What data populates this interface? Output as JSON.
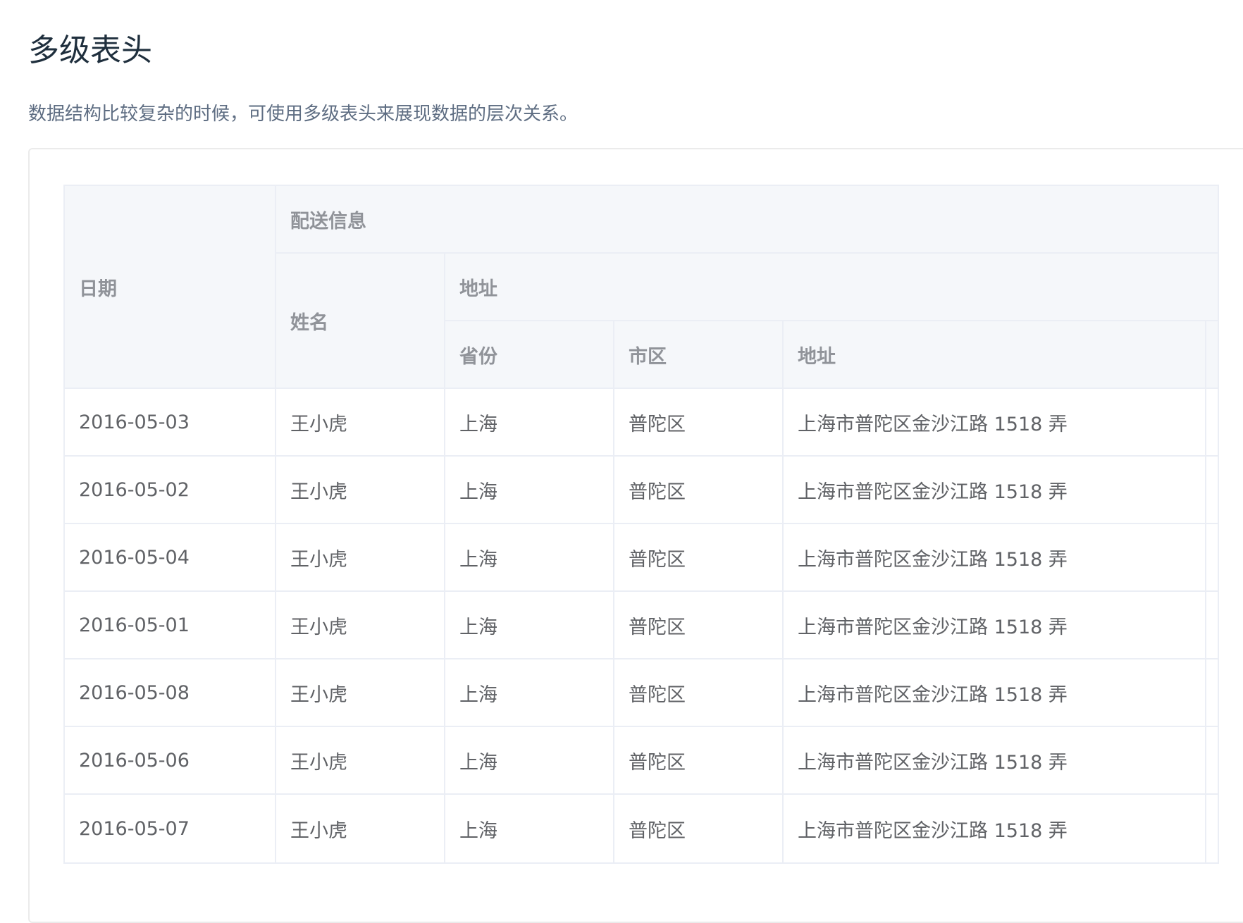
{
  "page": {
    "title": "多级表头",
    "description": "数据结构比较复杂的时候，可使用多级表头来展现数据的层次关系。"
  },
  "table": {
    "header": {
      "date": "日期",
      "delivery": "配送信息",
      "name": "姓名",
      "address_group": "地址",
      "province": "省份",
      "city": "市区",
      "address": "地址"
    },
    "rows": [
      {
        "date": "2016-05-03",
        "name": "王小虎",
        "province": "上海",
        "city": "普陀区",
        "address": "上海市普陀区金沙江路 1518 弄"
      },
      {
        "date": "2016-05-02",
        "name": "王小虎",
        "province": "上海",
        "city": "普陀区",
        "address": "上海市普陀区金沙江路 1518 弄"
      },
      {
        "date": "2016-05-04",
        "name": "王小虎",
        "province": "上海",
        "city": "普陀区",
        "address": "上海市普陀区金沙江路 1518 弄"
      },
      {
        "date": "2016-05-01",
        "name": "王小虎",
        "province": "上海",
        "city": "普陀区",
        "address": "上海市普陀区金沙江路 1518 弄"
      },
      {
        "date": "2016-05-08",
        "name": "王小虎",
        "province": "上海",
        "city": "普陀区",
        "address": "上海市普陀区金沙江路 1518 弄"
      },
      {
        "date": "2016-05-06",
        "name": "王小虎",
        "province": "上海",
        "city": "普陀区",
        "address": "上海市普陀区金沙江路 1518 弄"
      },
      {
        "date": "2016-05-07",
        "name": "王小虎",
        "province": "上海",
        "city": "普陀区",
        "address": "上海市普陀区金沙江路 1518 弄"
      }
    ]
  }
}
